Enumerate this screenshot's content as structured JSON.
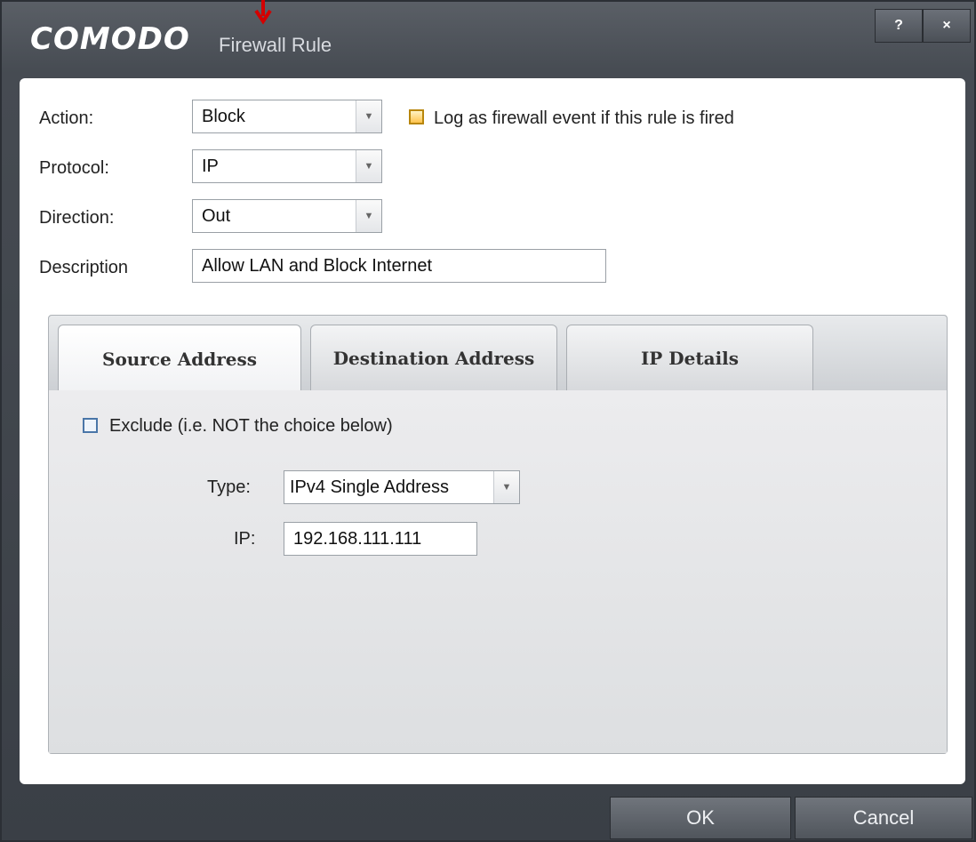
{
  "window": {
    "brand": "COMODO",
    "title": "Firewall Rule",
    "help_label": "?",
    "close_label": "×"
  },
  "form": {
    "action_label": "Action:",
    "action_value": "Block",
    "log_label": "Log as firewall event if this rule is fired",
    "protocol_label": "Protocol:",
    "protocol_value": "IP",
    "direction_label": "Direction:",
    "direction_value": "Out",
    "description_label": "Description",
    "description_value": "Allow LAN and Block Internet"
  },
  "tabs": [
    {
      "label": "Source Address",
      "active": true
    },
    {
      "label": "Destination Address",
      "active": false
    },
    {
      "label": "IP Details",
      "active": false
    }
  ],
  "source": {
    "exclude_label": "Exclude (i.e. NOT the choice below)",
    "type_label": "Type:",
    "type_value": "IPv4 Single Address",
    "ip_label": "IP:",
    "ip_value": "192.168.111.111"
  },
  "footer": {
    "ok_label": "OK",
    "cancel_label": "Cancel"
  },
  "colors": {
    "frame": "#464b52",
    "panel": "#ffffff",
    "arrow": "#d40000",
    "log_checkbox": "#ffc34d"
  }
}
